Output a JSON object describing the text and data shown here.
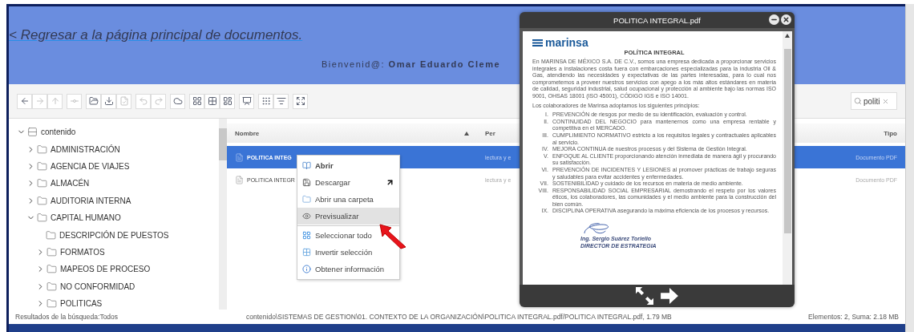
{
  "back_link": "< Regresar a la página principal de documentos.",
  "welcome": "Bienvenid@: **Omar Eduardo Cleme**",
  "toolbar": {
    "groups": [
      [
        {
          "disabled": false
        },
        {
          "disabled": true
        },
        {
          "disabled": true
        }
      ],
      [
        {
          "disabled": true
        }
      ],
      [
        {
          "disabled": false
        },
        {
          "disabled": false
        },
        {
          "disabled": true
        }
      ],
      [
        {
          "disabled": true
        },
        {
          "disabled": true
        }
      ],
      [
        {
          "disabled": false
        }
      ],
      [
        {
          "disabled": false
        },
        {
          "disabled": false
        },
        {
          "disabled": false
        }
      ],
      [
        {
          "disabled": false
        }
      ],
      [
        {
          "disabled": false
        },
        {
          "disabled": false
        }
      ],
      [
        {
          "disabled": false
        }
      ]
    ]
  },
  "search": {
    "value": "politi"
  },
  "tree": [
    {
      "label": "contenido",
      "kind": "root",
      "expanded": true,
      "children": [
        {
          "label": "ADMINISTRACIÓN",
          "kind": "folder",
          "expanded": false
        },
        {
          "label": "AGENCIA DE VIAJES",
          "kind": "folder",
          "expanded": false
        },
        {
          "label": "ALMACÉN",
          "kind": "folder",
          "expanded": false
        },
        {
          "label": "AUDITORIA INTERNA",
          "kind": "folder",
          "expanded": false
        },
        {
          "label": "CAPITAL HUMANO",
          "kind": "folder",
          "expanded": true,
          "children": [
            {
              "label": "DESCRIPCIÓN DE PUESTOS",
              "kind": "folder"
            },
            {
              "label": "FORMATOS",
              "kind": "folder",
              "expanded": false
            },
            {
              "label": "MAPEOS DE PROCESO",
              "kind": "folder",
              "expanded": false
            },
            {
              "label": "NO CONFORMIDAD",
              "kind": "folder",
              "expanded": false
            },
            {
              "label": "POLITICAS",
              "kind": "folder",
              "expanded": false
            }
          ]
        }
      ]
    }
  ],
  "table": {
    "columns": [
      {
        "label": "Nombre",
        "sorted": true
      },
      {
        "label": "Per",
        "sorted": false
      },
      {
        "label": "Tipo",
        "sorted": false
      }
    ],
    "rows": [
      {
        "name": "POLITICA INTEG",
        "permissions": "lectura y e",
        "type": "Documento PDF",
        "selected": true
      },
      {
        "name": "POLITICA INTEGR",
        "permissions": "lectura y e",
        "type": "Documento PDF",
        "selected": false
      }
    ]
  },
  "context_menu": [
    {
      "kind": "item",
      "label": "Abrir",
      "default": true,
      "selected": false,
      "submenu": false
    },
    {
      "kind": "item",
      "label": "Descargar",
      "default": false,
      "selected": false,
      "submenu": true
    },
    {
      "kind": "item",
      "label": "Abrir una carpeta",
      "default": false,
      "selected": false,
      "submenu": false
    },
    {
      "kind": "item",
      "label": "Previsualizar",
      "default": false,
      "selected": true,
      "submenu": false
    },
    {
      "kind": "separator"
    },
    {
      "kind": "item",
      "label": "Seleccionar todo",
      "default": false,
      "selected": false,
      "submenu": false
    },
    {
      "kind": "item",
      "label": "Invertir selección",
      "default": false,
      "selected": false,
      "submenu": false
    },
    {
      "kind": "item",
      "label": "Obtener información",
      "default": false,
      "selected": false,
      "submenu": false
    }
  ],
  "status_bar": {
    "left": "Resultados de la búsqueda:Todos",
    "path": "contenido\\SISTEMAS DE GESTION\\01. CONTEXTO DE LA ORGANIZACIÓN\\POLITICA INTEGRAL.pdf/POLITICA INTEGRAL.pdf, 1.79 MB",
    "right": "Elementos: 2, Suma: 2.18 MB"
  },
  "preview": {
    "title": "POLITICA INTEGRAL.pdf",
    "document": {
      "logo": "marinsa",
      "heading": "POLÍTICA INTEGRAL",
      "paragraph": "En MARINSA DE MÉXICO S.A. DE C.V., somos una empresa dedicada a proporcionar servicios integrales a instalaciones costa fuera con embarcaciones especializadas para la industria Oil & Gas, atendiendo las necesidades y expectativas de las partes interesadas, para lo cual nos comprometemos a proveer nuestros servicios con apego a los más altos estándares en materia de calidad, seguridad industrial, salud ocupacional y protección al ambiente bajo las normas ISO 9001, OHSAS 18001 (ISO 45001), CÓDIGO IGS e ISO 14001.",
      "intro": "Los colaboradores de  Marinsa adoptamos los siguientes principios:",
      "principles": [
        {
          "numeral": "I.",
          "text": "PREVENCIÓN de riesgos por medio de su identificación, evaluación y control."
        },
        {
          "numeral": "II.",
          "text": "CONTINUIDAD DEL NEGOCIO para mantenernos como una empresa rentable y competitiva en el MERCADO."
        },
        {
          "numeral": "III.",
          "text": "CUMPLIMIENTO NORMATIVO estricto a los requisitos legales y contractuales aplicables al servicio."
        },
        {
          "numeral": "IV.",
          "text": "MEJORA CONTINUA de nuestros procesos y del Sistema de Gestión Integral."
        },
        {
          "numeral": "V.",
          "text": "ENFOQUE AL CLIENTE proporcionando atención inmediata de manera ágil y procurando su satisfacción."
        },
        {
          "numeral": "VI.",
          "text": "PREVENCIÓN DE INCIDENTES Y LESIONES al promover prácticas de trabajo seguras y saludables para evitar accidentes y enfermedades."
        },
        {
          "numeral": "VII.",
          "text": "SOSTENIBILIDAD y cuidado de los recursos en materia de medio ambiente."
        },
        {
          "numeral": "VIII.",
          "text": "RESPONSABILIDAD SOCIAL EMPRESARIAL demostrando el respeto por los valores éticos, los colaboradores, las comunidades y el medio ambiente para la construcción del bien común."
        },
        {
          "numeral": "IX.",
          "text": "DISCIPLINA OPERATIVA asegurando la máxima eficiencia de los procesos y recursos."
        }
      ],
      "signature_name": "Ing. Sergio Suárez Toriello",
      "signature_title": "DIRECTOR DE ESTRATEGIA"
    }
  }
}
